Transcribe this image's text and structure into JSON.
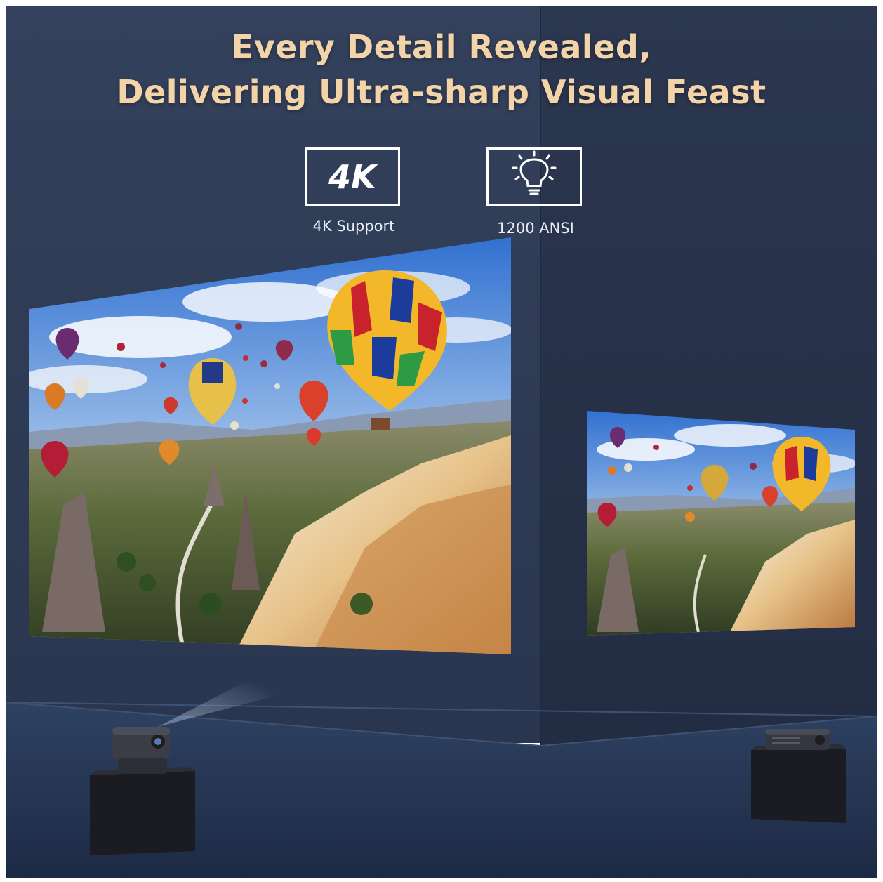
{
  "headline": {
    "line1": "Every Detail Revealed,",
    "line2": "Delivering Ultra-sharp Visual Feast"
  },
  "features": [
    {
      "icon": "4k-icon",
      "icon_text": "4K",
      "label": "4K Support"
    },
    {
      "icon": "lightbulb-icon",
      "label": "1200 ANSI"
    }
  ],
  "colors": {
    "headline": "#f3d3a8",
    "wall_left": "#2f3c55",
    "wall_right": "#27324a",
    "floor": "#2a3a58",
    "badge_border": "#ffffff"
  }
}
